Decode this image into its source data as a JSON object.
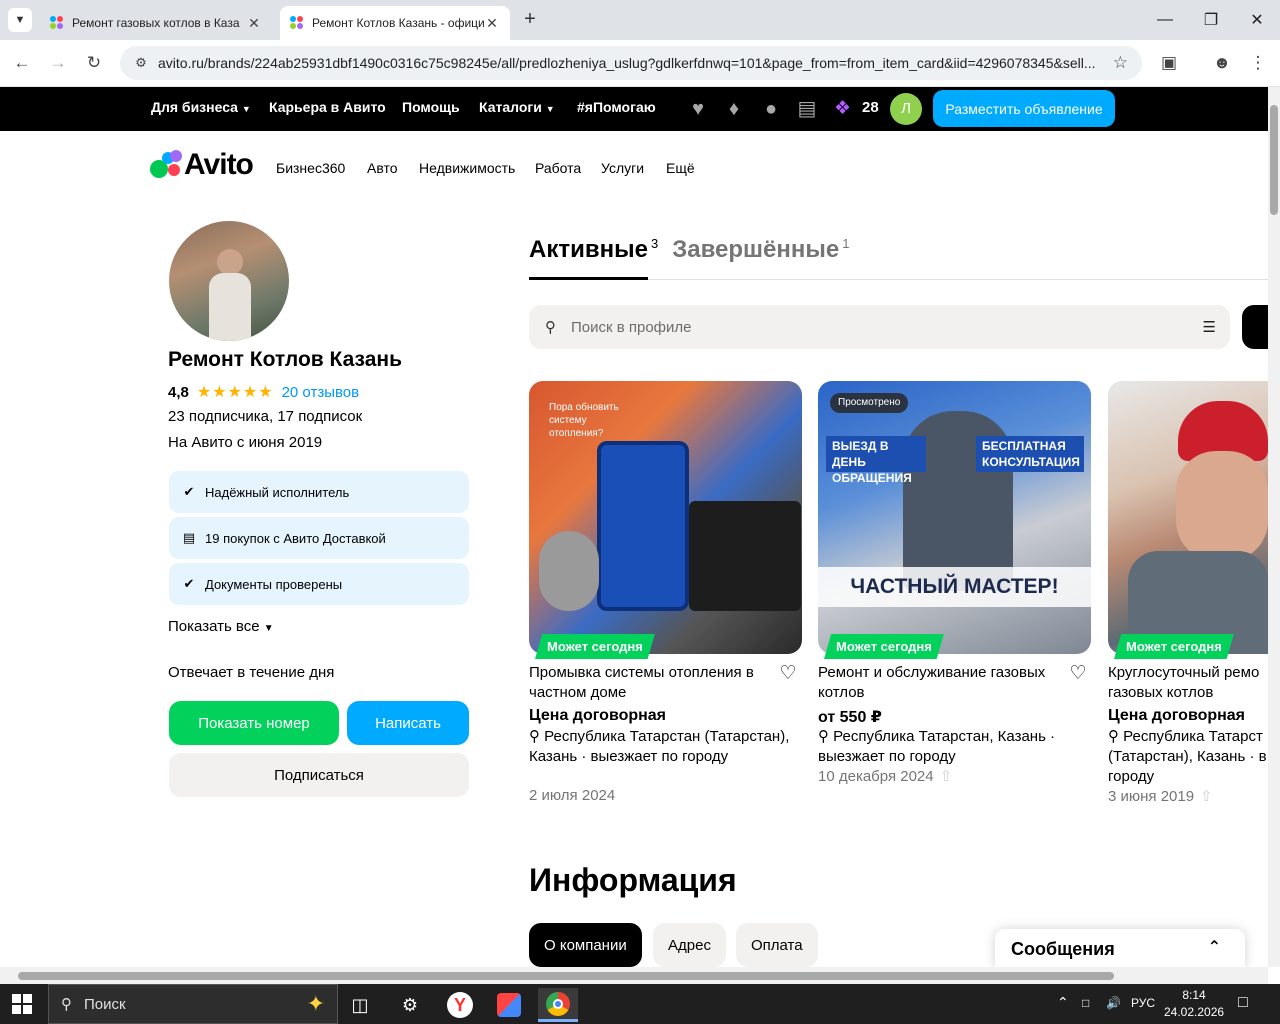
{
  "browser": {
    "tabs": [
      {
        "title": "Ремонт газовых котлов в Каза",
        "active": false
      },
      {
        "title": "Ремонт Котлов Казань - офици",
        "active": true
      }
    ],
    "url": "avito.ru/brands/224ab25931dbf1490c0316c75c98245e/all/predlozheniya_uslug?gdlkerfdnwq=101&page_from=from_item_card&iid=4296078345&sell..."
  },
  "topnav": {
    "for_business": "Для бизнеса",
    "career": "Карьера в Авито",
    "help": "Помощь",
    "catalogs": "Каталоги",
    "ipomogayu": "#яПомогаю",
    "coins_count": "28",
    "avatar_letter": "Л",
    "post_ad": "Разместить объявление"
  },
  "logo": {
    "text": "Avito"
  },
  "catnav": [
    "Бизнес360",
    "Авто",
    "Недвижимость",
    "Работа",
    "Услуги",
    "Ещё"
  ],
  "profile": {
    "name": "Ремонт Котлов Казань",
    "rating": "4,8",
    "reviews": "20 отзывов",
    "followers": "23 подписчика, 17 подписок",
    "since": "На Авито с июня 2019",
    "badges": [
      "Надёжный исполнитель",
      "19 покупок с Авито Доставкой",
      "Документы проверены"
    ],
    "show_all": "Показать все",
    "responds": "Отвечает в течение дня",
    "show_number": "Показать номер",
    "write": "Написать",
    "subscribe": "Подписаться"
  },
  "listing_tabs": {
    "active_label": "Активные",
    "active_count": "3",
    "done_label": "Завершённые",
    "done_count": "1"
  },
  "search": {
    "placeholder": "Поиск в профиле"
  },
  "cards": [
    {
      "title": "Промывка системы отопления в частном доме",
      "price": "Цена договорная",
      "location": "Республика Татарстан (Татарстан), Казань · выезжает по городу",
      "date": "2 июля 2024",
      "tag": "Может сегодня",
      "image_text": [
        "Пора обновить систему отопления?"
      ]
    },
    {
      "title": "Ремонт и обслуживание газовых котлов",
      "price": "от 550 ₽",
      "location": "Республика Татарстан, Казань · выезжает по городу",
      "date": "10 декабря 2024",
      "tag": "Может сегодня",
      "viewed": "Просмотрено",
      "image_text": [
        "ВЫЕЗД В ДЕНЬ ОБРАЩЕНИЯ",
        "БЕСПЛАТНАЯ КОНСУЛЬТАЦИЯ",
        "ЧАСТНЫЙ МАСТЕР!"
      ]
    },
    {
      "title": "Круглосуточный ремо газовых котлов",
      "price": "Цена договорная",
      "location": "Республика Татарст (Татарстан), Казань · в городу",
      "date": "3 июня 2019",
      "tag": "Может сегодня"
    }
  ],
  "info": {
    "title": "Информация",
    "chips": [
      "О компании",
      "Адрес",
      "Оплата"
    ]
  },
  "messages": {
    "label": "Сообщения"
  },
  "taskbar": {
    "search": "Поиск",
    "lang": "РУС",
    "time": "8:14",
    "date": "24.02.2026"
  },
  "colors": {
    "accent_blue": "#00aaff",
    "accent_green": "#02d15c",
    "badge_bg": "#e5f4fd",
    "star": "#ffb400",
    "link": "#0099f7"
  }
}
